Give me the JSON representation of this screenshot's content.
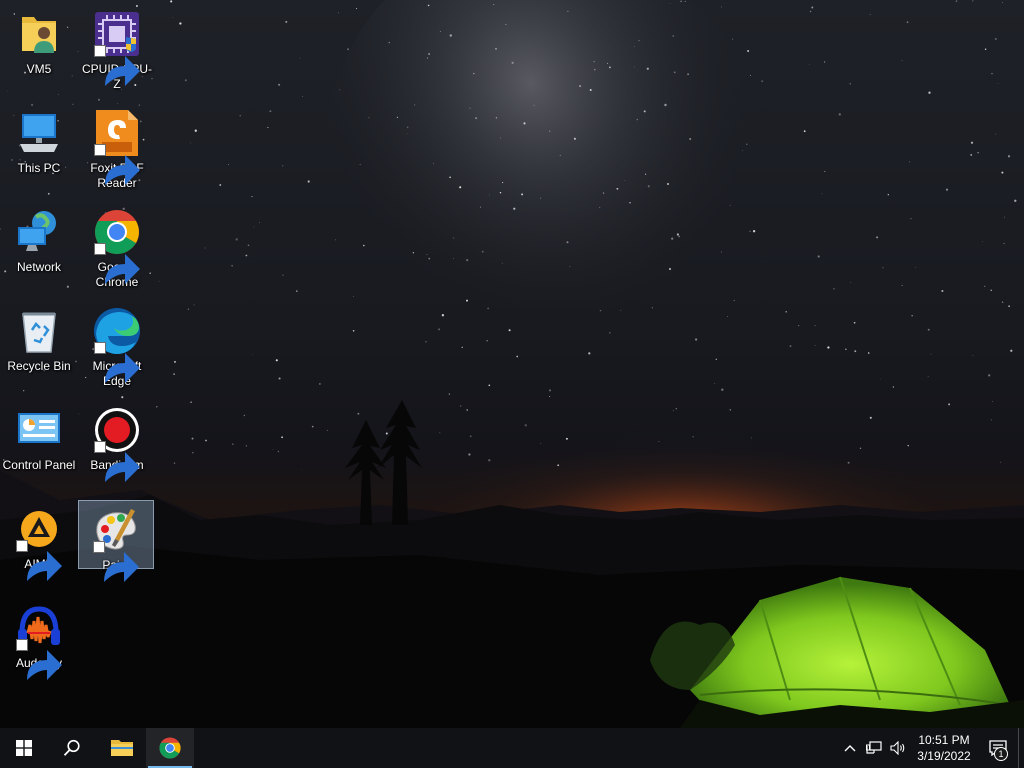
{
  "desktop": {
    "icons": [
      {
        "label": "VM5",
        "icon": "user-folder-icon",
        "shortcut": false
      },
      {
        "label": "CPUID CPU-Z",
        "icon": "cpuz-icon",
        "shortcut": true
      },
      {
        "label": "This PC",
        "icon": "this-pc-icon",
        "shortcut": false
      },
      {
        "label": "Foxit PDF Reader",
        "icon": "foxit-pdf-icon",
        "shortcut": true
      },
      {
        "label": "Network",
        "icon": "network-icon",
        "shortcut": false
      },
      {
        "label": "Google Chrome",
        "icon": "chrome-icon",
        "shortcut": true
      },
      {
        "label": "Recycle Bin",
        "icon": "recycle-bin-icon",
        "shortcut": false
      },
      {
        "label": "Microsoft Edge",
        "icon": "edge-icon",
        "shortcut": true
      },
      {
        "label": "Control Panel",
        "icon": "control-panel-icon",
        "shortcut": false
      },
      {
        "label": "Bandicam",
        "icon": "bandicam-icon",
        "shortcut": true
      },
      {
        "label": "AIMP",
        "icon": "aimp-icon",
        "shortcut": true
      },
      {
        "label": "Paint",
        "icon": "paint-icon",
        "shortcut": true,
        "selected": true
      },
      {
        "label": "Audacity",
        "icon": "audacity-icon",
        "shortcut": true
      }
    ]
  },
  "taskbar": {
    "start_icon": "windows-start-icon",
    "search_icon": "search-icon",
    "pinned": [
      {
        "name": "File Explorer",
        "icon": "file-explorer-icon",
        "active": false
      },
      {
        "name": "Google Chrome",
        "icon": "chrome-icon",
        "active": true
      }
    ],
    "tray": {
      "icons": [
        "chevron-up-icon",
        "network-wired-icon",
        "speaker-icon"
      ],
      "time": "10:51 PM",
      "date": "3/19/2022",
      "notification_count": "1"
    }
  },
  "colors": {
    "taskbar_bg": "#101216",
    "selection": "#aac8eb",
    "active_indicator": "#76b9ed"
  }
}
